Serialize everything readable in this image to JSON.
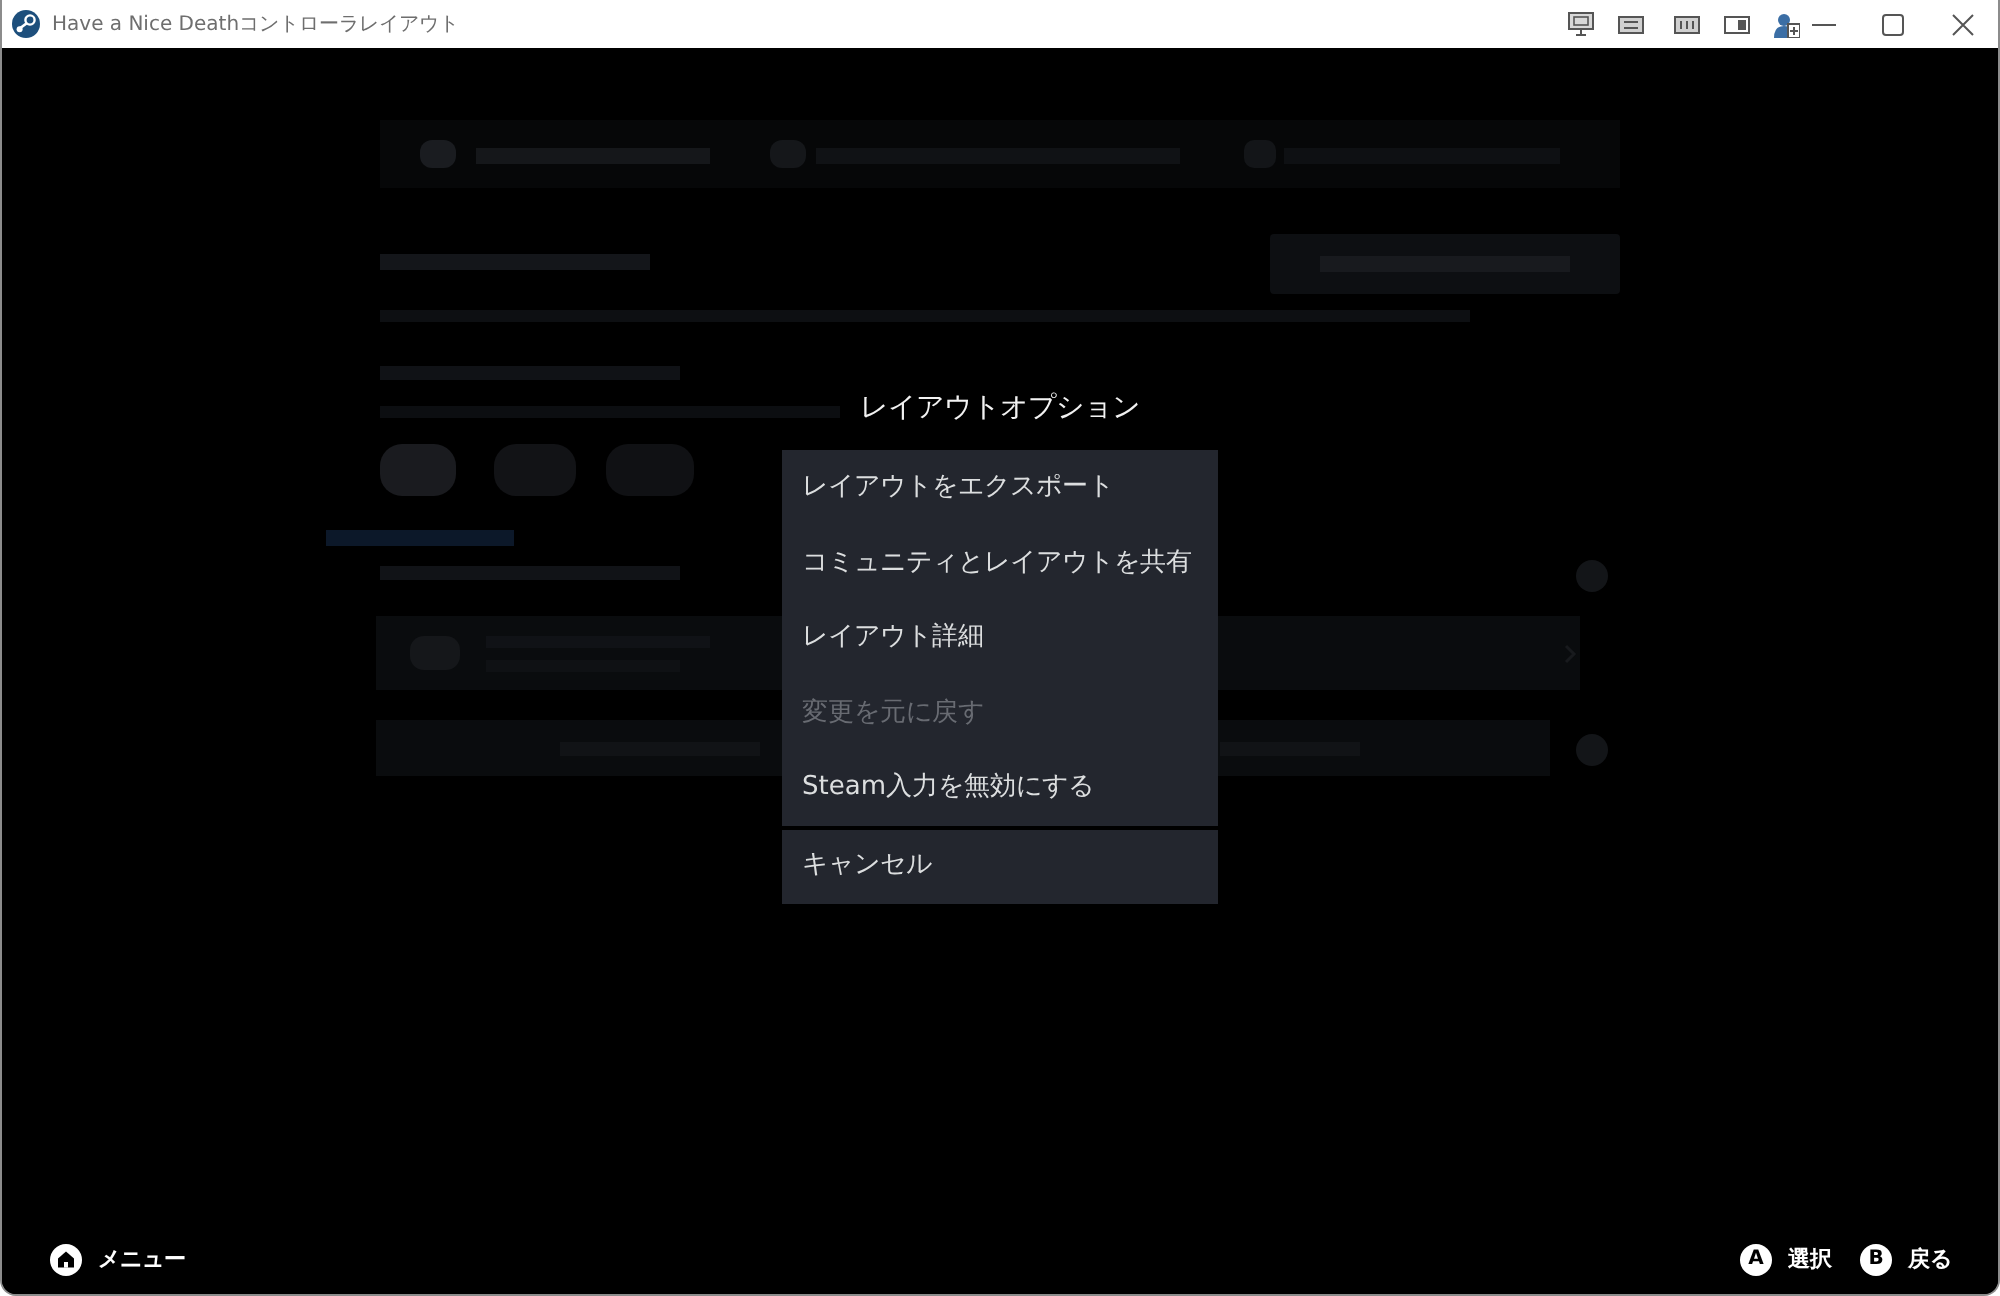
{
  "window": {
    "title": "Have a Nice Deathコントローラレイアウト"
  },
  "dialog": {
    "title": "レイアウトオプション",
    "items": [
      {
        "kind": "option",
        "label": "レイアウトをエクスポート",
        "disabled": false,
        "selected": false
      },
      {
        "kind": "option",
        "label": "コミュニティとレイアウトを共有",
        "disabled": false,
        "selected": false
      },
      {
        "kind": "option",
        "label": "レイアウト詳細",
        "disabled": false,
        "selected": false
      },
      {
        "kind": "option",
        "label": "変更を元に戻す",
        "disabled": true,
        "selected": false
      },
      {
        "kind": "option",
        "label": "Steam入力を無効にする",
        "disabled": false,
        "selected": false
      },
      {
        "kind": "cancel",
        "label": "キャンセル",
        "disabled": false,
        "selected": false
      }
    ]
  },
  "footer": {
    "left": [
      {
        "kind": "home",
        "label": "メニュー"
      }
    ],
    "right": [
      {
        "kind": "letter",
        "glyph": "A",
        "label": "選択"
      },
      {
        "kind": "letter",
        "glyph": "B",
        "label": "戻る"
      }
    ]
  }
}
